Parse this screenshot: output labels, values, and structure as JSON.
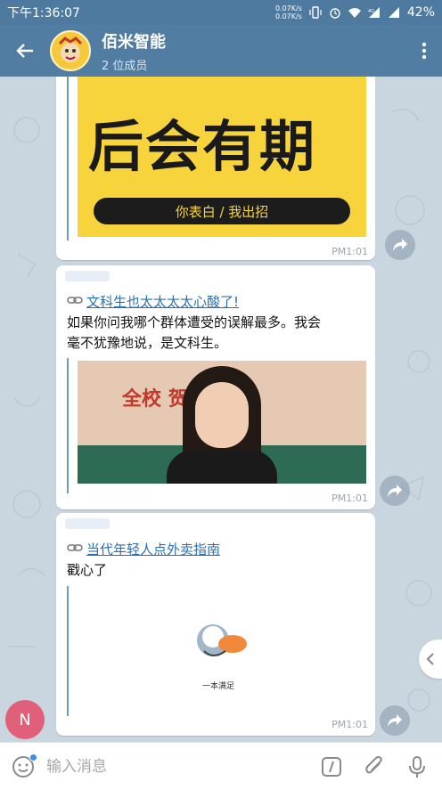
{
  "status_bar": {
    "time": "下午1:36:07",
    "net_up": "0.07K/s",
    "net_down": "0.07K/s",
    "battery": "42%"
  },
  "header": {
    "title": "佰米智能",
    "subtitle": "2 位成员"
  },
  "messages": [
    {
      "image_caption": "后会有期",
      "image_subcaption": "你表白 / 我出招",
      "time": "PM1:01"
    },
    {
      "link_title": "文科生也太太太太心酸了!",
      "text_line1": "如果你问我哪个群体遭受的误解最多。我会",
      "text_line2": "毫不犹豫地说，是文科生。",
      "image_text": "全校  贺",
      "time": "PM1:01"
    },
    {
      "link_title": "当代年轻人点外卖指南",
      "text_line1": "戳心了",
      "image_text": "一本满足",
      "time": "PM1:01"
    }
  ],
  "composer": {
    "placeholder": "输入消息"
  },
  "fab_label": "N",
  "colors": {
    "header": "#527da3",
    "status_bar": "#4e7aa0",
    "link": "#2a6fb5",
    "chat_bg": "#c9d5df"
  }
}
